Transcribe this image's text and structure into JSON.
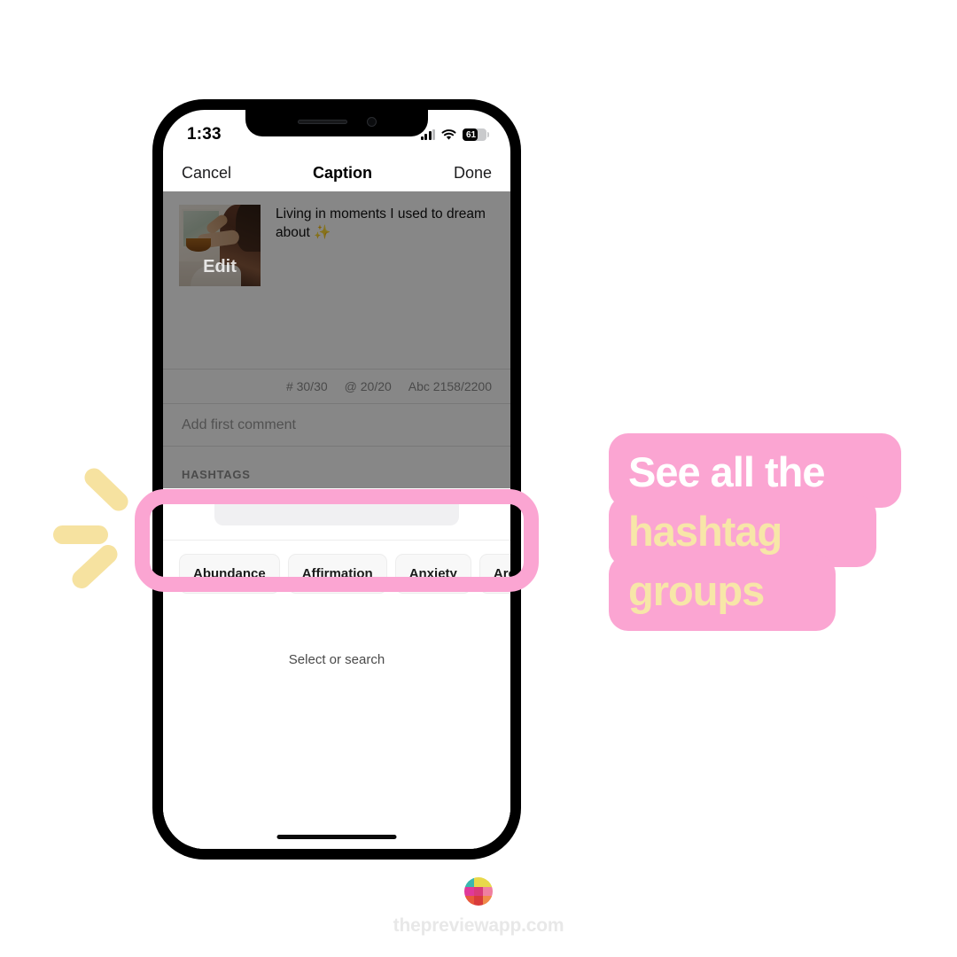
{
  "phone": {
    "status_bar": {
      "time": "1:33",
      "signal_icon": "cellular-signal-icon",
      "wifi_icon": "wifi-icon",
      "battery_level": "61",
      "battery_icon": "battery-icon"
    },
    "nav_bar": {
      "cancel_label": "Cancel",
      "title": "Caption",
      "done_label": "Done"
    },
    "caption_editor": {
      "thumbnail_overlay_label": "Edit",
      "caption_text": "Living in moments I used to dream about ✨",
      "counters": {
        "hashtags": "# 30/30",
        "mentions": "@ 20/20",
        "characters": "Abc 2158/2200"
      },
      "first_comment_placeholder": "Add first comment",
      "hashtags_section_label": "HASHTAGS"
    },
    "hashtag_sheet": {
      "search_placeholder": "",
      "chips": [
        "Abundance",
        "Affirmation",
        "Anxiety",
        "Aromatherapy"
      ],
      "empty_state_text": "Select or search"
    }
  },
  "callout": {
    "line_1": "See all the",
    "line_2": "hashtag",
    "line_3": "groups",
    "bg_color": "#fba5d2",
    "line_1_color": "#ffffff",
    "accent_color": "#f7e6a8"
  },
  "highlight": {
    "frame_color": "#fba5d2"
  },
  "decoration": {
    "dash_color": "#f6e2a0"
  },
  "footer": {
    "logo_icon": "preview-app-grid-logo-icon",
    "logo_colors": [
      "#3ab7b0",
      "#e8d84a",
      "#e8d84a",
      "#e0399a",
      "#d93b7a",
      "#f07fa0",
      "#e8593c",
      "#d93b3b",
      "#f08a4a"
    ],
    "url": "thepreviewapp.com"
  }
}
